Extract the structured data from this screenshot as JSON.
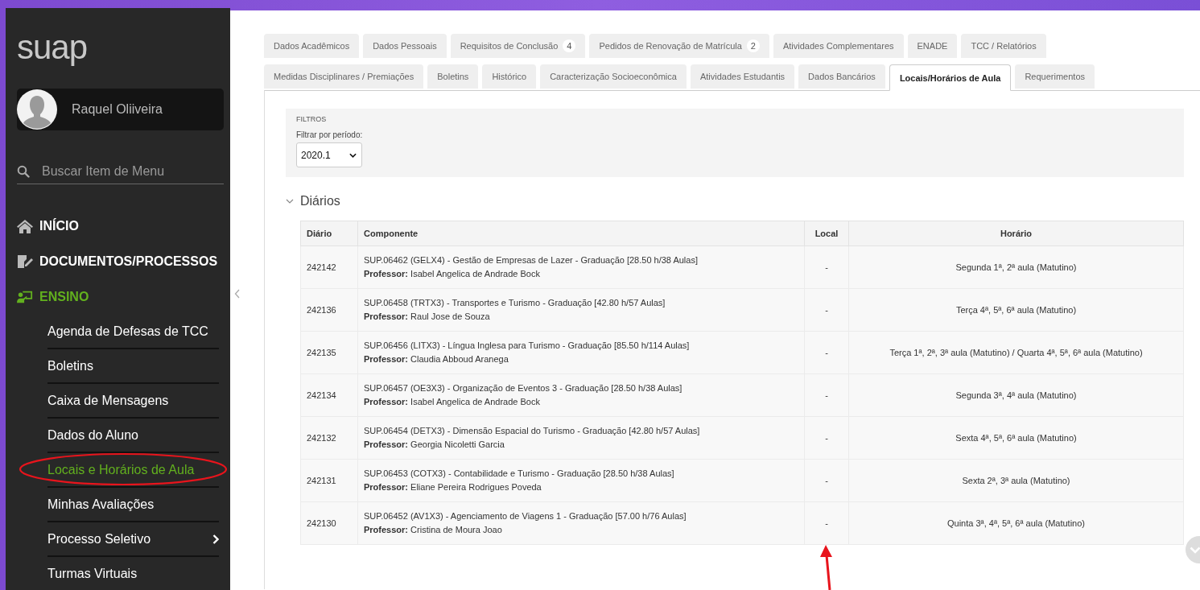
{
  "sidebar": {
    "logo": "suap",
    "user": {
      "name": "Raquel Oliiveira"
    },
    "search": {
      "placeholder": "Buscar Item de Menu"
    },
    "menu": [
      {
        "label": "INÍCIO",
        "selected": false
      },
      {
        "label": "DOCUMENTOS/PROCESSOS",
        "selected": false
      },
      {
        "label": "ENSINO",
        "selected": true,
        "children": [
          {
            "label": "Agenda de Defesas de TCC",
            "selected": false,
            "has_submenu": false
          },
          {
            "label": "Boletins",
            "selected": false,
            "has_submenu": false
          },
          {
            "label": "Caixa de Mensagens",
            "selected": false,
            "has_submenu": false
          },
          {
            "label": "Dados do Aluno",
            "selected": false,
            "has_submenu": false
          },
          {
            "label": "Locais e Horários de Aula",
            "selected": true,
            "has_submenu": false
          },
          {
            "label": "Minhas Avaliações",
            "selected": false,
            "has_submenu": false
          },
          {
            "label": "Processo Seletivo",
            "selected": false,
            "has_submenu": true
          },
          {
            "label": "Turmas Virtuais",
            "selected": false,
            "has_submenu": false
          }
        ]
      }
    ]
  },
  "tabs": [
    [
      {
        "label": "Dados Acadêmicos",
        "selected": false
      },
      {
        "label": "Dados Pessoais",
        "selected": false
      },
      {
        "label": "Requisitos de Conclusão",
        "count": "4",
        "selected": false
      },
      {
        "label": "Pedidos de Renovação de Matrícula",
        "count": "2",
        "selected": false
      },
      {
        "label": "Atividades Complementares",
        "selected": false
      },
      {
        "label": "ENADE",
        "selected": false
      },
      {
        "label": "TCC / Relatórios",
        "selected": false
      }
    ],
    [
      {
        "label": "Medidas Disciplinares / Premiações",
        "selected": false
      },
      {
        "label": "Boletins",
        "selected": false
      },
      {
        "label": "Histórico",
        "selected": false
      },
      {
        "label": "Caracterização Socioeconômica",
        "selected": false
      },
      {
        "label": "Atividades Estudantis",
        "selected": false
      },
      {
        "label": "Dados Bancários",
        "selected": false
      },
      {
        "label": "Locais/Horários de Aula",
        "selected": true
      },
      {
        "label": "Requerimentos",
        "selected": false
      }
    ]
  ],
  "filters": {
    "title": "FILTROS",
    "label": "Filtrar por período:",
    "value": "2020.1"
  },
  "section": {
    "title": "Diários",
    "expanded": true
  },
  "table": {
    "columns": [
      "Diário",
      "Componente",
      "Local",
      "Horário"
    ],
    "rows": [
      {
        "diario": "242142",
        "componente": "SUP.06462 (GELX4) - Gestão de Empresas de Lazer - Graduação [28.50 h/38 Aulas]",
        "professor_label": "Professor:",
        "professor": "Isabel Angelica de Andrade Bock",
        "local": "-",
        "horario": "Segunda 1ª, 2ª aula (Matutino)"
      },
      {
        "diario": "242136",
        "componente": "SUP.06458 (TRTX3) - Transportes e Turismo - Graduação [42.80 h/57 Aulas]",
        "professor_label": "Professor:",
        "professor": "Raul Jose de Souza",
        "local": "-",
        "horario": "Terça 4ª, 5ª, 6ª aula (Matutino)"
      },
      {
        "diario": "242135",
        "componente": "SUP.06456 (LITX3) - Língua Inglesa para Turismo - Graduação [85.50 h/114 Aulas]",
        "professor_label": "Professor:",
        "professor": "Claudia Abboud Aranega",
        "local": "-",
        "horario": "Terça 1ª, 2ª, 3ª aula (Matutino) / Quarta 4ª, 5ª, 6ª aula (Matutino)"
      },
      {
        "diario": "242134",
        "componente": "SUP.06457 (OE3X3) - Organização de Eventos 3 - Graduação [28.50 h/38 Aulas]",
        "professor_label": "Professor:",
        "professor": "Isabel Angelica de Andrade Bock",
        "local": "-",
        "horario": "Segunda 3ª, 4ª aula (Matutino)"
      },
      {
        "diario": "242132",
        "componente": "SUP.06454 (DETX3) - Dimensão Espacial do Turismo - Graduação [42.80 h/57 Aulas]",
        "professor_label": "Professor:",
        "professor": "Georgia Nicoletti Garcia",
        "local": "-",
        "horario": "Sexta 4ª, 5ª, 6ª aula (Matutino)"
      },
      {
        "diario": "242131",
        "componente": "SUP.06453 (COTX3) - Contabilidade e Turismo - Graduação [28.50 h/38 Aulas]",
        "professor_label": "Professor:",
        "professor": "Eliane Pereira Rodrigues Poveda",
        "local": "-",
        "horario": "Sexta 2ª, 3ª aula (Matutino)"
      },
      {
        "diario": "242130",
        "componente": "SUP.06452 (AV1X3) - Agenciamento de Viagens 1 - Graduação [57.00 h/76 Aulas]",
        "professor_label": "Professor:",
        "professor": "Cristina de Moura Joao",
        "local": "-",
        "horario": "Quinta 3ª, 4ª, 5ª, 6ª aula (Matutino)"
      }
    ]
  }
}
